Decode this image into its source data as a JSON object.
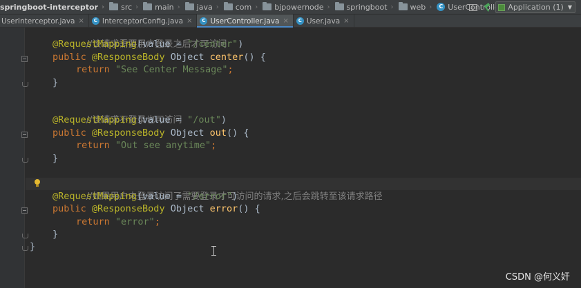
{
  "breadcrumb": [
    {
      "label": "springboot-interceptor",
      "icon": "none"
    },
    {
      "label": "src",
      "icon": "folder-icon"
    },
    {
      "label": "main",
      "icon": "folder-icon"
    },
    {
      "label": "java",
      "icon": "folder-icon"
    },
    {
      "label": "com",
      "icon": "folder-icon"
    },
    {
      "label": "bjpowernode",
      "icon": "folder-icon"
    },
    {
      "label": "springboot",
      "icon": "folder-icon"
    },
    {
      "label": "web",
      "icon": "folder-icon"
    },
    {
      "label": "UserController",
      "icon": "class-icon"
    }
  ],
  "run_config": {
    "label": "Application (1)"
  },
  "tabs": [
    {
      "label": "UserInterceptor.java",
      "active": false
    },
    {
      "label": "InterceptorConfig.java",
      "active": false
    },
    {
      "label": "UserController.java",
      "active": true
    },
    {
      "label": "User.java",
      "active": false
    }
  ],
  "icons": {
    "class": "C",
    "close": "×",
    "dropdown": "▼",
    "separator": "›"
  },
  "code": {
    "comment1": "//该请求需要用户登录之后才可访问",
    "map1_ann": "@RequestMapping",
    "map1_open": "(value = ",
    "map1_val": "\"/center\"",
    "sig1_kw": "public ",
    "sig1_ann": "@ResponseBody",
    "sig1_type": " Object ",
    "sig1_fn": "center",
    "sig1_end": "() {",
    "ret1_kw": "return ",
    "ret1_val": "\"See Center Message\"",
    "semi": ";",
    "close_paren": ")",
    "brace": "}",
    "comment2": "//该请求不登录也可访问",
    "map2_ann": "@RequestMapping",
    "map2_open": "(value = ",
    "map2_val": "\"/out\"",
    "sig2_kw": "public ",
    "sig2_ann": "@ResponseBody",
    "sig2_type": " Object ",
    "sig2_fn": "out",
    "sig2_end": "() {",
    "ret2_kw": "return ",
    "ret2_val": "\"Out see anytime\"",
    "comment3": "//如果用户未登录访问了需要登录才可访问的请求,之后会跳转至该请求路径",
    "map3_ann": "@RequestMapping",
    "map3_open": "(value = ",
    "map3_val": "\"/error\"",
    "sig3_kw": "public ",
    "sig3_ann": "@ResponseBody",
    "sig3_type": " Object ",
    "sig3_fn": "error",
    "sig3_end": "() {",
    "ret3_kw": "return ",
    "ret3_val": "\"error\""
  },
  "watermark": "CSDN @何义奸",
  "colors": {
    "editor_bg": "#2b2b2b",
    "comment": "#808080",
    "annotation": "#bbb529",
    "keyword": "#cc7832",
    "string": "#6a8759",
    "method": "#ffc66d",
    "text": "#a9b7c6"
  }
}
